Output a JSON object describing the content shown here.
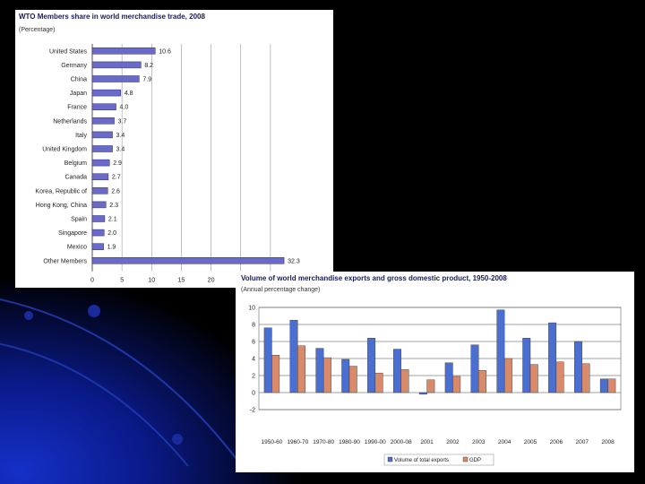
{
  "colors": {
    "background": "#000000",
    "gradient_blue": "#0a1a8a",
    "bar_blue": "#6a6ac8",
    "export_blue": "#4a6fd0",
    "gdp_salmon": "#d98a6a",
    "title_navy": "#1a1a5a"
  },
  "chart_data": [
    {
      "type": "bar",
      "orientation": "horizontal",
      "title": "WTO Members share in world merchandise trade, 2008",
      "subtitle": "(Percentage)",
      "categories": [
        "United States",
        "Germany",
        "China",
        "Japan",
        "France",
        "Netherlands",
        "Italy",
        "United Kingdom",
        "Belgium",
        "Canada",
        "Korea, Republic of",
        "Hong Kong, China",
        "Spain",
        "Singapore",
        "Mexico",
        "Other Members"
      ],
      "values": [
        10.6,
        8.2,
        7.9,
        4.8,
        4.0,
        3.7,
        3.4,
        3.4,
        2.9,
        2.7,
        2.6,
        2.3,
        2.1,
        2.0,
        1.9,
        32.3
      ],
      "value_labels": [
        "10.6",
        "8.2",
        "7.9",
        "4.8",
        "4.0",
        "3.7",
        "3.4",
        "3.4",
        "2.9",
        "2.7",
        "2.6",
        "2.3",
        "2.1",
        "2.0",
        "1.9",
        "32.3"
      ],
      "xticks": [
        "0",
        "5",
        "10",
        "15",
        "20"
      ],
      "xlim": [
        0,
        35
      ],
      "grid": true
    },
    {
      "type": "bar",
      "title": "Volume of world merchandise exports and gross domestic product, 1950-2008",
      "subtitle": "(Annual percentage change)",
      "categories": [
        "1950-60",
        "1960-70",
        "1970-80",
        "1980-90",
        "1990-00",
        "2000-08",
        "2001",
        "2002",
        "2003",
        "2004",
        "2005",
        "2006",
        "2007",
        "2008"
      ],
      "series": [
        {
          "name": "Volume of total exports",
          "values": [
            7.6,
            8.5,
            5.2,
            3.9,
            6.4,
            5.1,
            -0.2,
            3.5,
            5.6,
            9.7,
            6.4,
            8.2,
            6.0,
            1.6
          ]
        },
        {
          "name": "GDP",
          "values": [
            4.4,
            5.5,
            4.1,
            3.1,
            2.3,
            2.7,
            1.5,
            1.9,
            2.6,
            4.0,
            3.3,
            3.6,
            3.4,
            1.6
          ]
        }
      ],
      "yticks": [
        "-2",
        "0",
        "2",
        "4",
        "6",
        "8",
        "10"
      ],
      "ylim": [
        -2,
        10
      ],
      "grid": true,
      "legend": "bottom"
    }
  ]
}
